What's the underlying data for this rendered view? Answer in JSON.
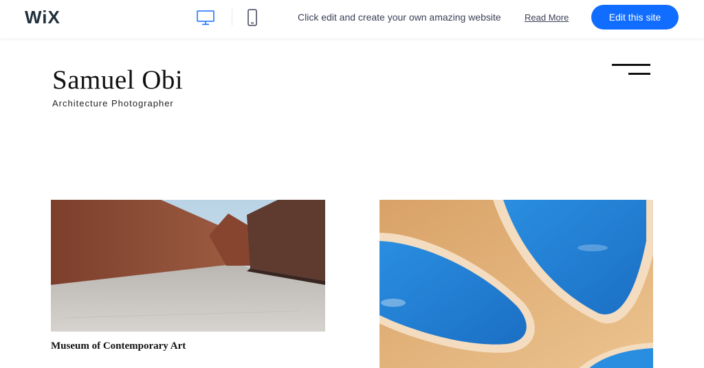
{
  "wix_bar": {
    "logo_text": "WiX",
    "promo_text": "Click edit and create your own amazing website",
    "read_more_label": "Read More",
    "edit_button_label": "Edit this site",
    "desktop_icon": "desktop-icon",
    "mobile_icon": "mobile-icon"
  },
  "site": {
    "title": "Samuel Obi",
    "subtitle": "Architecture Photographer",
    "menu_icon": "hamburger-menu-icon"
  },
  "gallery": {
    "items": [
      {
        "caption": "Museum of Contemporary Art"
      },
      {
        "caption": ""
      }
    ]
  },
  "colors": {
    "accent": "#116dff",
    "text_dark": "#20303c",
    "sky_blue": "#1f7fd6",
    "rust_wall": "#8e4a34",
    "sand": "#e2ad70"
  }
}
